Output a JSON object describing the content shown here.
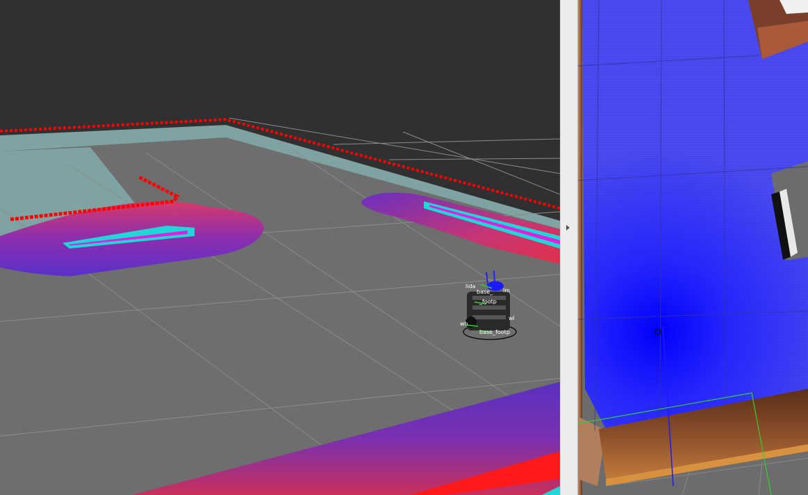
{
  "left_view": {
    "robot_frame_labels": [
      "lida",
      "im",
      "base_",
      "_footp",
      "wl",
      "wh",
      "base_footp"
    ]
  },
  "right_view": {},
  "colors": {
    "background": "#303030",
    "floor": "#6e6e6e",
    "unknown_region": "#7fa3a3",
    "obstacle_red": "#ff0000",
    "inflation_cyan": "#1fd7d7",
    "lethal_magenta": "#e020e0",
    "costmap_purple": "#6a2ec0",
    "gazebo_blue": "#2b2bff",
    "wall_wood": "#8a4e2a"
  }
}
